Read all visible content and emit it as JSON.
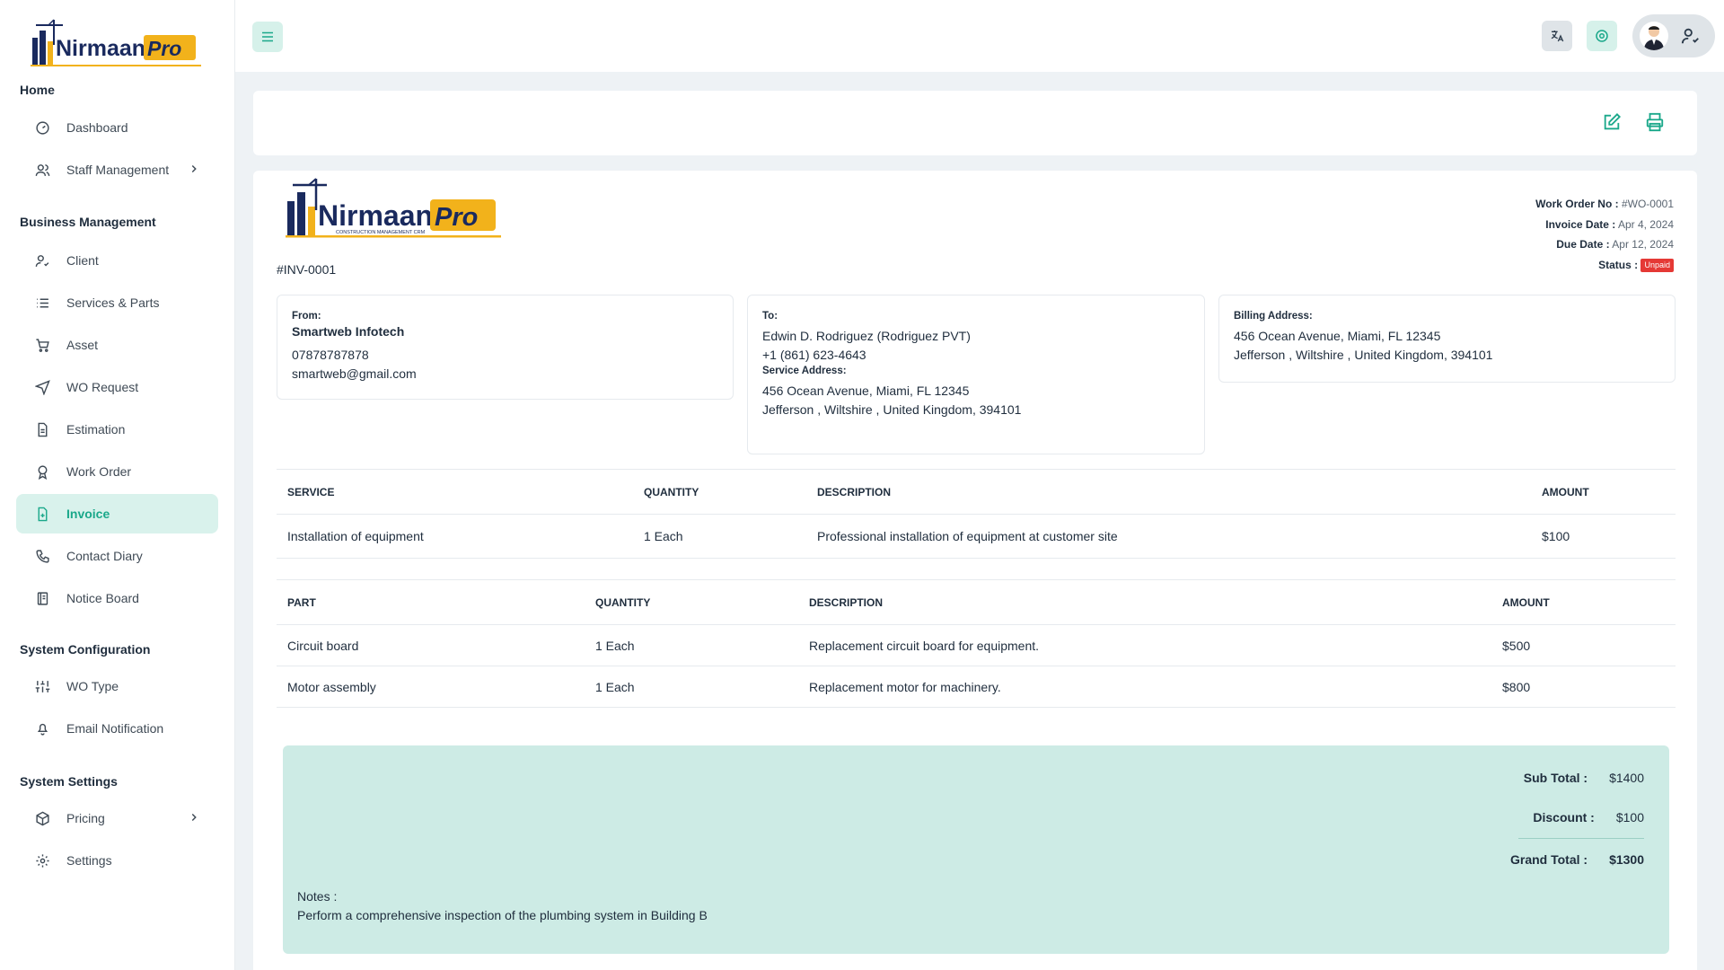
{
  "brand": {
    "name": "Nirmaan",
    "suffix": "Pro",
    "tagline": "CONSTRUCTION MANAGEMENT CRM"
  },
  "sidebar": {
    "sections": [
      {
        "label": "Home"
      },
      {
        "label": "Business Management"
      },
      {
        "label": "System Configuration"
      },
      {
        "label": "System Settings"
      }
    ],
    "items": [
      {
        "label": "Dashboard",
        "icon": "dashboard-icon"
      },
      {
        "label": "Staff Management",
        "icon": "users-icon"
      },
      {
        "label": "Client",
        "icon": "user-check-icon"
      },
      {
        "label": "Services & Parts",
        "icon": "list-icon"
      },
      {
        "label": "Asset",
        "icon": "cart-icon"
      },
      {
        "label": "WO Request",
        "icon": "send-icon"
      },
      {
        "label": "Estimation",
        "icon": "file-icon"
      },
      {
        "label": "Work Order",
        "icon": "award-icon"
      },
      {
        "label": "Invoice",
        "icon": "file-plus-icon"
      },
      {
        "label": "Contact Diary",
        "icon": "phone-icon"
      },
      {
        "label": "Notice Board",
        "icon": "notebook-icon"
      },
      {
        "label": "WO Type",
        "icon": "sliders-icon"
      },
      {
        "label": "Email Notification",
        "icon": "bell-icon"
      },
      {
        "label": "Pricing",
        "icon": "box-icon"
      },
      {
        "label": "Settings",
        "icon": "gear-icon"
      }
    ],
    "active": "Invoice",
    "accent": "#1aa88a"
  },
  "invoice": {
    "number": "#INV-0001",
    "meta": {
      "work_order_label": "Work Order No :",
      "work_order_value": "#WO-0001",
      "invoice_date_label": "Invoice Date :",
      "invoice_date_value": "Apr 4, 2024",
      "due_date_label": "Due Date :",
      "due_date_value": "Apr 12, 2024",
      "status_label": "Status :",
      "status_value": "Unpaid"
    },
    "from": {
      "label": "From:",
      "name": "Smartweb Infotech",
      "phone": "07878787878",
      "email": "smartweb@gmail.com"
    },
    "to": {
      "label": "To:",
      "name": "Edwin D. Rodriguez (Rodriguez PVT)",
      "phone": "+1 (861) 623-4643",
      "service_label": "Service Address:",
      "address1": "456 Ocean Avenue, Miami, FL 12345",
      "address2": "Jefferson , Wiltshire , United Kingdom, 394101"
    },
    "billing": {
      "label": "Billing Address:",
      "address1": "456 Ocean Avenue, Miami, FL 12345",
      "address2": "Jefferson , Wiltshire , United Kingdom, 394101"
    },
    "services": {
      "headers": [
        "SERVICE",
        "QUANTITY",
        "DESCRIPTION",
        "AMOUNT"
      ],
      "rows": [
        [
          "Installation of equipment",
          "1 Each",
          "Professional installation of equipment at customer site",
          "$100"
        ]
      ]
    },
    "parts": {
      "headers": [
        "PART",
        "QUANTITY",
        "DESCRIPTION",
        "AMOUNT"
      ],
      "rows": [
        [
          "Circuit board",
          "1 Each",
          "Replacement circuit board for equipment.",
          "$500"
        ],
        [
          "Motor assembly",
          "1 Each",
          "Replacement motor for machinery.",
          "$800"
        ]
      ]
    },
    "summary": {
      "subtotal_label": "Sub Total :",
      "subtotal_value": "$1400",
      "discount_label": "Discount :",
      "discount_value": "$100",
      "grand_label": "Grand Total :",
      "grand_value": "$1300"
    },
    "notes": {
      "label": "Notes :",
      "text": "Perform a comprehensive inspection of the plumbing system in Building B"
    }
  },
  "colors": {
    "accent": "#1aa88a",
    "accent_light": "#d6f1ea",
    "summary_bg": "#cdebe5",
    "status_red": "#e53935"
  }
}
